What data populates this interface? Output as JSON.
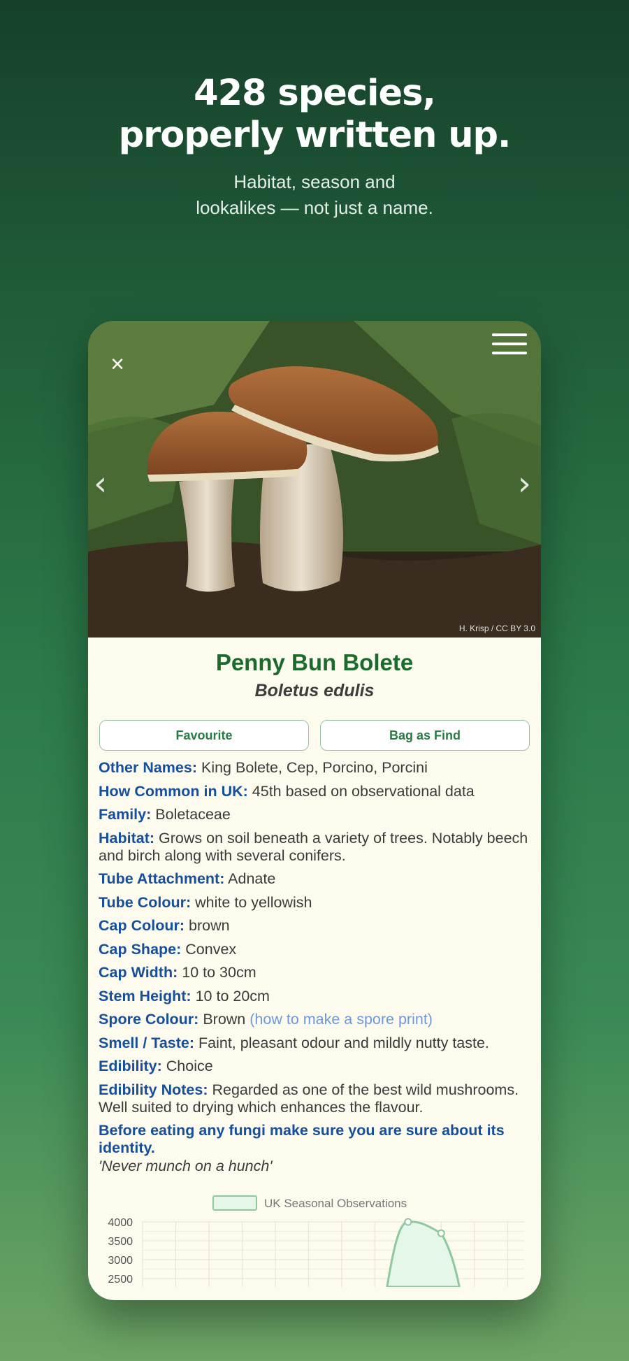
{
  "hero": {
    "title_line1": "428 species,",
    "title_line2": "properly written up.",
    "subtitle_line1": "Habitat, season and",
    "subtitle_line2": "lookalikes — not just a name."
  },
  "photo": {
    "credit": "H. Krisp / CC BY 3.0",
    "close_icon": "×",
    "prev_icon": "‹",
    "next_icon": "›",
    "icons": [
      "close-icon",
      "menu-icon",
      "chevron-left-icon",
      "chevron-right-icon"
    ]
  },
  "species": {
    "common_name": "Penny Bun Bolete",
    "latin_name": "Boletus edulis"
  },
  "actions": {
    "favourite": "Favourite",
    "bag": "Bag as Find"
  },
  "facts": [
    {
      "label": "Other Names:",
      "value": "King Bolete, Cep, Porcino, Porcini"
    },
    {
      "label": "How Common in UK:",
      "value": "45th based on observational data"
    },
    {
      "label": "Family:",
      "value": "Boletaceae"
    },
    {
      "label": "Habitat:",
      "value": "Grows on soil beneath a variety of trees. Notably beech and birch along with several conifers."
    },
    {
      "label": "Tube Attachment:",
      "value": "Adnate"
    },
    {
      "label": "Tube Colour:",
      "value": "white to yellowish"
    },
    {
      "label": "Cap Colour:",
      "value": "brown"
    },
    {
      "label": "Cap Shape:",
      "value": "Convex"
    },
    {
      "label": "Cap Width:",
      "value": "10 to 30cm"
    },
    {
      "label": "Stem Height:",
      "value": "10 to 20cm"
    },
    {
      "label": "Spore Colour:",
      "value": "Brown",
      "link": "(how to make a spore print)"
    },
    {
      "label": "Smell / Taste:",
      "value": "Faint, pleasant odour and mildly nutty taste."
    },
    {
      "label": "Edibility:",
      "value": "Choice"
    },
    {
      "label": "Edibility Notes:",
      "value": "Regarded as one of the best wild mushrooms. Well suited to drying which enhances the flavour."
    }
  ],
  "warning": "Before eating any fungi make sure you are sure about its identity.",
  "motto": "'Never munch on a hunch'",
  "colors": {
    "label_blue": "#164f9c",
    "title_green": "#1a6b2c",
    "chart_line": "#8ec89e",
    "chart_fill": "#e4f7e9"
  },
  "chart_data": {
    "type": "area",
    "legend": "UK Seasonal Observations",
    "y_ticks": [
      "4000",
      "3500",
      "3000",
      "2500"
    ],
    "ylim": [
      2500,
      4000
    ],
    "x_count": 12,
    "series": [
      {
        "name": "UK Seasonal Observations",
        "values": [
          null,
          null,
          null,
          null,
          null,
          null,
          null,
          null,
          4000,
          3700,
          null,
          null
        ]
      }
    ]
  }
}
